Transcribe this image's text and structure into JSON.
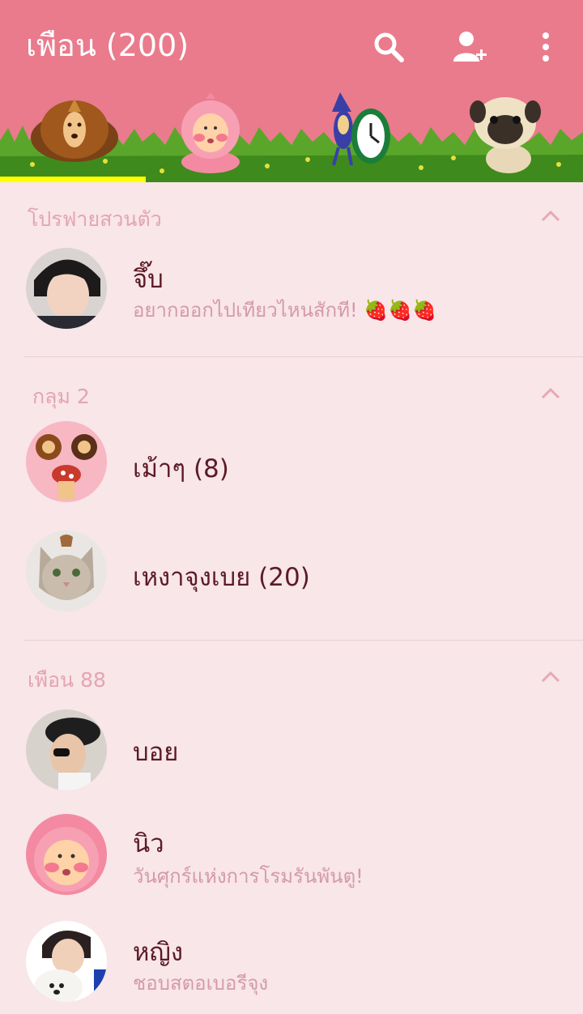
{
  "header": {
    "title": "เพือน (200)",
    "icons": [
      "search-icon",
      "add-friend-icon",
      "more-vertical-icon"
    ]
  },
  "theme": {
    "header_bg": "#e97b8d",
    "list_bg": "#f8e6e9",
    "indicator": "#ffff00"
  },
  "tabs": [
    {
      "icon": "chestnut-character-icon",
      "selected": true
    },
    {
      "icon": "pink-hood-character-icon",
      "selected": false
    },
    {
      "icon": "clock-character-icon",
      "selected": false
    },
    {
      "icon": "pug-dog-icon",
      "selected": false
    }
  ],
  "sections": {
    "profile": {
      "title": "โปรฟายสวนตัว"
    },
    "groups": {
      "title": "กลุม 2"
    },
    "friends": {
      "title": "เพือน 88"
    }
  },
  "profile": {
    "name": "จึ๊บ",
    "status": "อยากออกไปเทียวไหนสักที!",
    "status_emoji": "🍓🍓🍓"
  },
  "groups": [
    {
      "name": "เม้าๆ (8)"
    },
    {
      "name": "เหงาจุงเบย (20)"
    }
  ],
  "friends": [
    {
      "name": "บอย",
      "status": ""
    },
    {
      "name": "นิว",
      "status": "วันศุกร์แห่งการโรมรันพันตู!"
    },
    {
      "name": "หญิง",
      "status": "ชอบสตอเบอรีจุง"
    }
  ]
}
